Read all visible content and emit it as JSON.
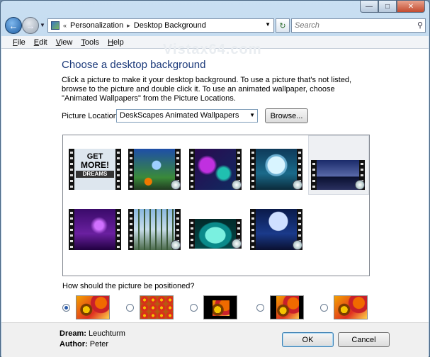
{
  "window": {
    "controls": [
      "minimize",
      "maximize",
      "close"
    ]
  },
  "nav": {
    "breadcrumb": [
      "Personalization",
      "Desktop Background"
    ],
    "overflow": "«",
    "search_placeholder": "Search"
  },
  "menu": [
    "File",
    "Edit",
    "View",
    "Tools",
    "Help"
  ],
  "watermark": "Vistax64.com",
  "page": {
    "title": "Choose a desktop background",
    "description": "Click a picture to make it your desktop background. To use a picture that's not listed, browse to the picture and double click it. To use an animated wallpaper, choose \"Animated Wallpapers\" from the Picture Locations.",
    "location_label": "Picture Location",
    "location_value": "DeskScapes Animated Wallpapers",
    "browse_label": "Browse...",
    "thumb_text": [
      "GET",
      "MORE!",
      "DREAMS"
    ],
    "position_question": "How should the picture be positioned?",
    "position_options": [
      "fit-to-screen",
      "tile",
      "center",
      "center-fill",
      "stretch"
    ],
    "selected_position": 0,
    "selected_thumb": 4
  },
  "footer": {
    "dream_label": "Dream:",
    "dream_value": "Leuchturm",
    "author_label": "Author:",
    "author_value": "Peter",
    "ok_label": "OK",
    "cancel_label": "Cancel"
  },
  "colors": {
    "title": "#1c3a7a",
    "accent": "#2b5cab"
  }
}
